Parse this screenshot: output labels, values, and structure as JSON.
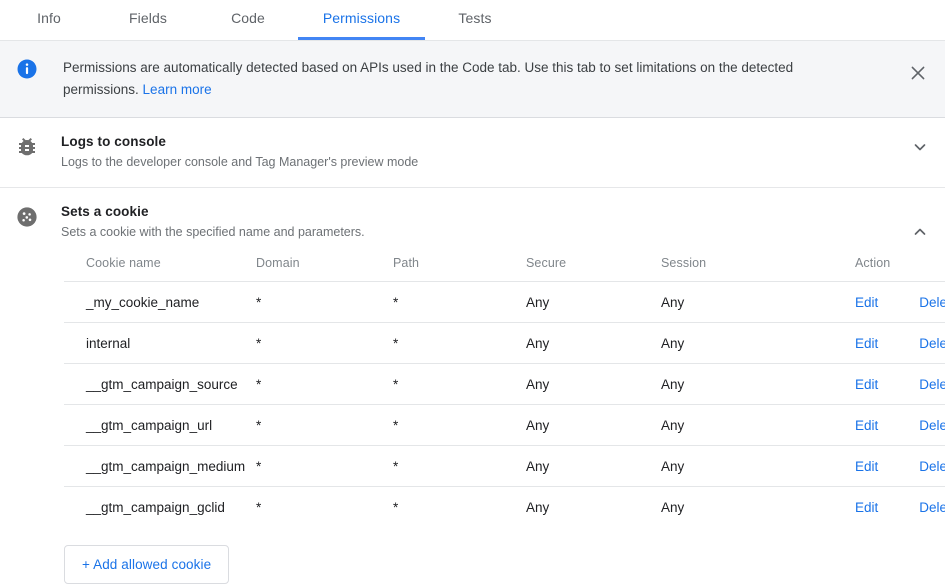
{
  "tabs": [
    {
      "label": "Info",
      "active": false
    },
    {
      "label": "Fields",
      "active": false
    },
    {
      "label": "Code",
      "active": false
    },
    {
      "label": "Permissions",
      "active": true
    },
    {
      "label": "Tests",
      "active": false
    }
  ],
  "banner": {
    "icon": "info-icon",
    "text": "Permissions are automatically detected based on APIs used in the Code tab. Use this tab to set limitations on the detected permissions.",
    "link_label": "Learn more",
    "close_icon": "close-icon"
  },
  "permissions": [
    {
      "icon": "bug-icon",
      "title": "Logs to console",
      "subtitle": "Logs to the developer console and Tag Manager's preview mode",
      "expanded": false,
      "chevron": "chevron-down-icon"
    },
    {
      "icon": "cookie-icon",
      "title": "Sets a cookie",
      "subtitle": "Sets a cookie with the specified name and parameters.",
      "expanded": true,
      "chevron": "chevron-up-icon"
    }
  ],
  "cookie_table": {
    "columns": [
      "Cookie name",
      "Domain",
      "Path",
      "Secure",
      "Session",
      "Action"
    ],
    "rows": [
      {
        "name": "_my_cookie_name",
        "domain": "*",
        "path": "*",
        "secure": "Any",
        "session": "Any",
        "edit": "Edit",
        "delete": "Delete"
      },
      {
        "name": "internal",
        "domain": "*",
        "path": "*",
        "secure": "Any",
        "session": "Any",
        "edit": "Edit",
        "delete": "Delete"
      },
      {
        "name": "__gtm_campaign_source",
        "domain": "*",
        "path": "*",
        "secure": "Any",
        "session": "Any",
        "edit": "Edit",
        "delete": "Delete"
      },
      {
        "name": "__gtm_campaign_url",
        "domain": "*",
        "path": "*",
        "secure": "Any",
        "session": "Any",
        "edit": "Edit",
        "delete": "Delete"
      },
      {
        "name": "__gtm_campaign_medium",
        "domain": "*",
        "path": "*",
        "secure": "Any",
        "session": "Any",
        "edit": "Edit",
        "delete": "Delete"
      },
      {
        "name": "__gtm_campaign_gclid",
        "domain": "*",
        "path": "*",
        "secure": "Any",
        "session": "Any",
        "edit": "Edit",
        "delete": "Delete"
      }
    ],
    "add_button_label": "+ Add allowed cookie"
  },
  "colors": {
    "accent": "#1a73e8",
    "tab_underline": "#4285f4",
    "banner_bg": "#f5f6f8",
    "icon_gray": "#6e6e6e",
    "divider": "#e4e6e8",
    "text_primary": "#202124",
    "text_secondary": "#6d7175",
    "header_text": "#80868b"
  }
}
